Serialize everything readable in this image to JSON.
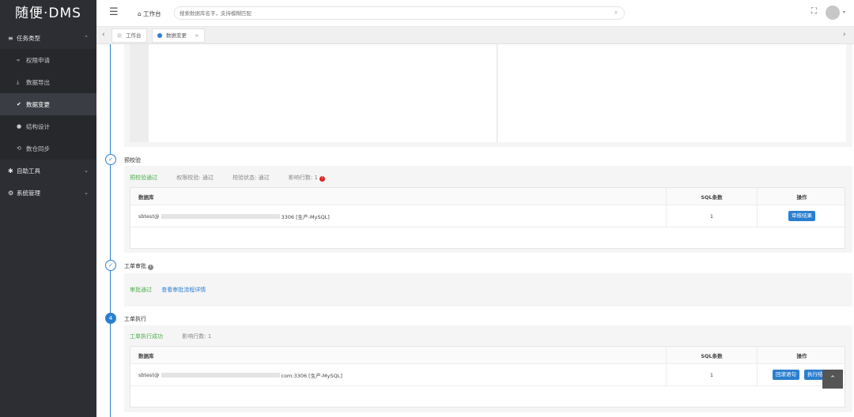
{
  "app": {
    "logo": "随便·DMS"
  },
  "sidebar": {
    "groups": [
      {
        "label": "任务类型",
        "icon": "list-icon"
      },
      {
        "label": "自助工具",
        "icon": "wrench-icon"
      },
      {
        "label": "系统管理",
        "icon": "gear-icon"
      }
    ],
    "items": [
      {
        "label": "权限申请",
        "icon": "filter-icon"
      },
      {
        "label": "数据导出",
        "icon": "download-icon"
      },
      {
        "label": "数据变更",
        "icon": "check-circle-icon",
        "active": true
      },
      {
        "label": "结构设计",
        "icon": "circle-icon"
      },
      {
        "label": "数仓同步",
        "icon": "sync-icon"
      }
    ]
  },
  "topbar": {
    "home": "工作台",
    "search_placeholder": "搜索数据库名字，支持模糊匹配"
  },
  "tabs": [
    {
      "label": "工作台"
    },
    {
      "label": "数据变更",
      "active": true
    }
  ],
  "steps": {
    "precheck": {
      "title": "预校验",
      "status": "预校验通过",
      "perm_label": "权限校验:",
      "perm_value": "通过",
      "check_label": "校验状态:",
      "check_value": "通过",
      "rows_label": "影响行数:",
      "rows_value": "1",
      "table": {
        "headers": [
          "数据库",
          "SQL条数",
          "操作"
        ],
        "rows": [
          {
            "db_prefix": "sbtest@",
            "db_suffix": "3306 [生产-MySQL]",
            "count": "1",
            "action": "审核结果"
          }
        ]
      }
    },
    "approval": {
      "title": "工单审批",
      "status": "审批通过",
      "link": "查看审批流程详情"
    },
    "execute": {
      "number": "4",
      "title": "工单执行",
      "status": "工单执行成功",
      "rows_label": "影响行数:",
      "rows_value": "1",
      "table": {
        "headers": [
          "数据库",
          "SQL条数",
          "操作"
        ],
        "rows": [
          {
            "db_prefix": "sbtest@",
            "db_suffix": "com:3306 [生产-MySQL]",
            "count": "1",
            "action1": "回滚语句",
            "action2": "执行结果"
          }
        ]
      }
    }
  },
  "colors": {
    "accent": "#2b7fd0",
    "success": "#4cae4c",
    "sidebar_bg": "#2c2e33"
  }
}
